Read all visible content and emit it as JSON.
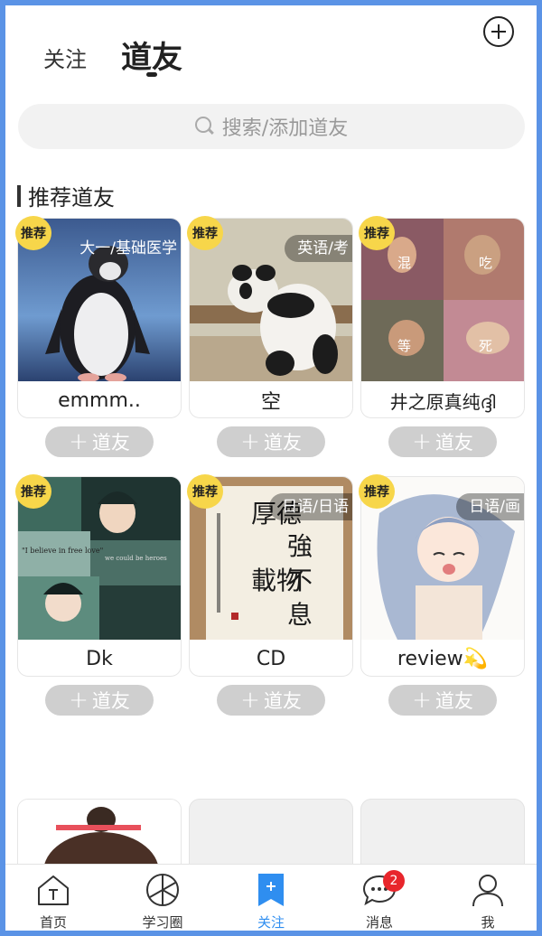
{
  "header": {
    "tab_follow": "关注",
    "tab_friends": "道友"
  },
  "search": {
    "placeholder": "搜索/添加道友"
  },
  "section": {
    "title": "推荐道友"
  },
  "cards": [
    {
      "name": "emmm..",
      "tag": "大一/基础医学",
      "badge": "推荐",
      "follow": "道友"
    },
    {
      "name": "空",
      "tag": "英语/考",
      "badge": "推荐",
      "follow": "道友"
    },
    {
      "name": "井之原真纯ദ്ദി",
      "tag": "",
      "badge": "推荐",
      "follow": "道友",
      "image_text": [
        "混",
        "吃",
        "等",
        "死"
      ]
    },
    {
      "name": "Dk",
      "tag": "",
      "badge": "推荐",
      "follow": "道友",
      "image_text": [
        "\"I believe in free love\"",
        "we could be heroes"
      ]
    },
    {
      "name": "CD",
      "tag": "日语/日语",
      "badge": "推荐",
      "follow": "道友",
      "image_text": [
        "厚德",
        "強",
        "載物",
        "不",
        "息"
      ]
    },
    {
      "name": "review💫",
      "tag": "日语/画",
      "badge": "推荐",
      "follow": "道友"
    }
  ],
  "bottom_nav": {
    "home": "首页",
    "circle": "学习圈",
    "follow": "关注",
    "messages": "消息",
    "messages_badge": "2",
    "me": "我"
  },
  "colors": {
    "accent": "#2f8ef0",
    "badge": "#f7d64a",
    "notification": "#e8262c"
  },
  "icons": {
    "add": "plus-circle-icon",
    "search": "search-icon",
    "home": "home-icon",
    "circle": "aperture-icon",
    "follow": "bookmark-plus-icon",
    "messages": "chat-bubble-icon",
    "me": "user-icon"
  }
}
